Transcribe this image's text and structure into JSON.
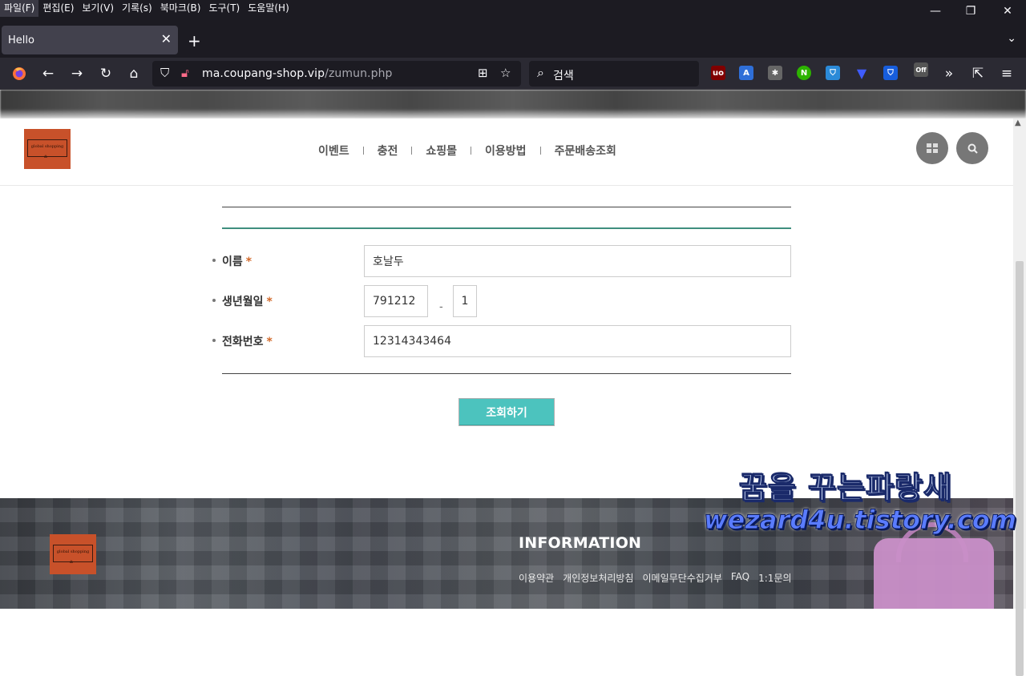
{
  "menubar": {
    "items": [
      "파일(F)",
      "편집(E)",
      "보기(V)",
      "기록(s)",
      "북마크(B)",
      "도구(T)",
      "도움말(H)"
    ]
  },
  "window": {
    "minimize": "—",
    "restore": "❐",
    "close": "✕"
  },
  "tab": {
    "title": "Hello",
    "close": "✕",
    "new_tab": "+"
  },
  "navbar": {
    "url_host": "ma.coupang-shop.vip",
    "url_path": "/zumun.php",
    "search_placeholder": "검색",
    "ext_off_label": "Off"
  },
  "site": {
    "logo_text": "global shopping",
    "nav": [
      "이벤트",
      "충전",
      "쇼핑몰",
      "이용방법",
      "주문배송조회"
    ]
  },
  "form": {
    "name_label": "이름",
    "birth_label": "생년월일",
    "phone_label": "전화번호",
    "required_mark": "*",
    "name_value": "호날두",
    "birth_value": "791212",
    "birth_separator": "-",
    "gender_value": "1",
    "phone_value": "12314343464",
    "submit_label": "조회하기"
  },
  "footer": {
    "title": "INFORMATION",
    "links": [
      "이용약관",
      "개인정보처리방침",
      "이메일무단수집거부",
      "FAQ",
      "1:1문의"
    ]
  },
  "watermark": {
    "line1": "꿈을 꾸는파랑새",
    "line2": "wezard4u.tistory.com"
  },
  "colors": {
    "accent_green": "#3f8f7f",
    "submit_bg": "#4cc3be",
    "required": "#d2692a",
    "logo_bg": "#c8512a"
  }
}
